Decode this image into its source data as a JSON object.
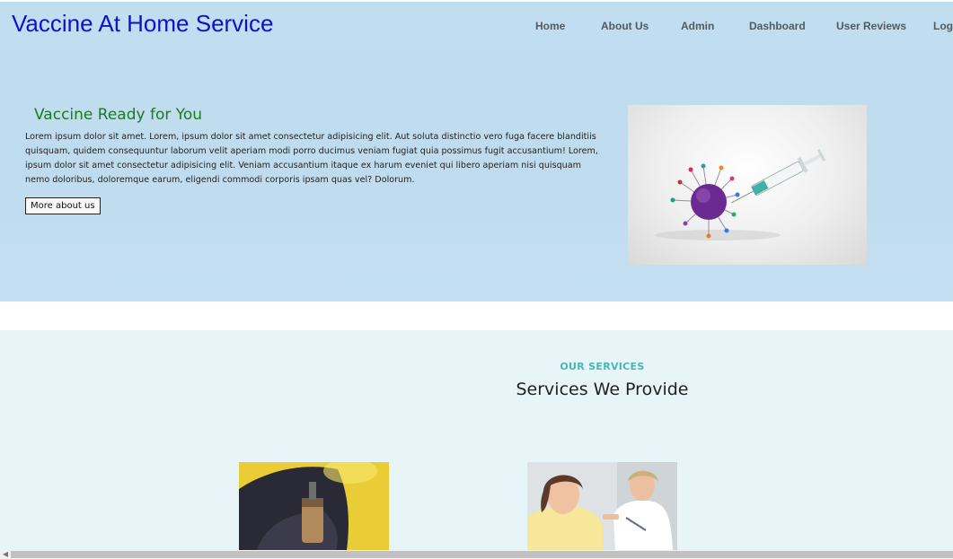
{
  "header": {
    "brand": "Vaccine At Home Service",
    "nav": [
      "Home",
      "About Us",
      "Admin",
      "Dashboard",
      "User Reviews",
      "Login"
    ]
  },
  "hero": {
    "title": "Vaccine Ready for You",
    "text": "Lorem ipsum dolor sit amet. Lorem, ipsum dolor sit amet consectetur adipisicing elit. Aut soluta distinctio vero fuga facere blanditiis quisquam, quidem consequuntur laborum velit aperiam modi porro ducimus veniam fugiat quia possimus fugit accusantium! Lorem, ipsum dolor sit amet consectetur adipisicing elit. Veniam accusantium itaque ex harum eveniet qui libero aperiam nisi quisquam nemo doloribus, doloremque earum, eligendi commodi corporis ipsam quas vel? Dolorum.",
    "button_label": "More about us",
    "image_icon": "virus-syringe-image"
  },
  "services": {
    "kicker": "OUR SERVICES",
    "title": "Services We Provide",
    "images": [
      "vaccine-vial-image",
      "child-vaccination-image"
    ]
  },
  "colors": {
    "brand": "#1010cc",
    "hero_title": "#1e7a1e",
    "kicker": "#45b8b5",
    "hero_bg": "#c1def0",
    "services_bg": "#e7f5f9"
  }
}
